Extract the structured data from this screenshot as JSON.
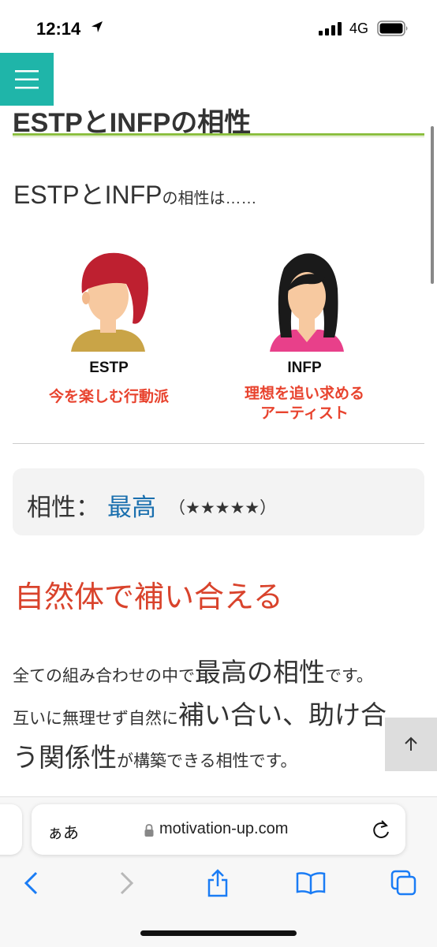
{
  "status_bar": {
    "time": "12:14",
    "network": "4G"
  },
  "article": {
    "title": "ESTPとINFPの相性",
    "intro_main": "ESTPとINFP",
    "intro_suffix": "の相性は……"
  },
  "illustration": {
    "left": {
      "type": "ESTP",
      "description": "今を楽しむ行動派"
    },
    "right": {
      "type": "INFP",
      "description_line1": "理想を追い求める",
      "description_line2": "アーティスト"
    }
  },
  "compatibility": {
    "label": "相性：",
    "value": "最高",
    "stars": "（★★★★★）"
  },
  "section_heading": "自然体で補い合える",
  "body": {
    "l1a": "全ての組み合わせの中で",
    "l1b": "最高の相性",
    "l1c": "です。",
    "l2a": "互いに無理せず自然に",
    "l2b": "補い合い、助け合",
    "l3a": "う関係性",
    "l3b": "が構築できる相性です。"
  },
  "browser": {
    "text_size_label": "ぁあ",
    "url": "motivation-up.com"
  },
  "colors": {
    "accent_teal": "#1fb5a9",
    "heading_red": "#d9432c",
    "link_blue": "#1a6fae",
    "title_rule_green": "#8bbf3f",
    "ios_blue": "#1a7cf5"
  }
}
